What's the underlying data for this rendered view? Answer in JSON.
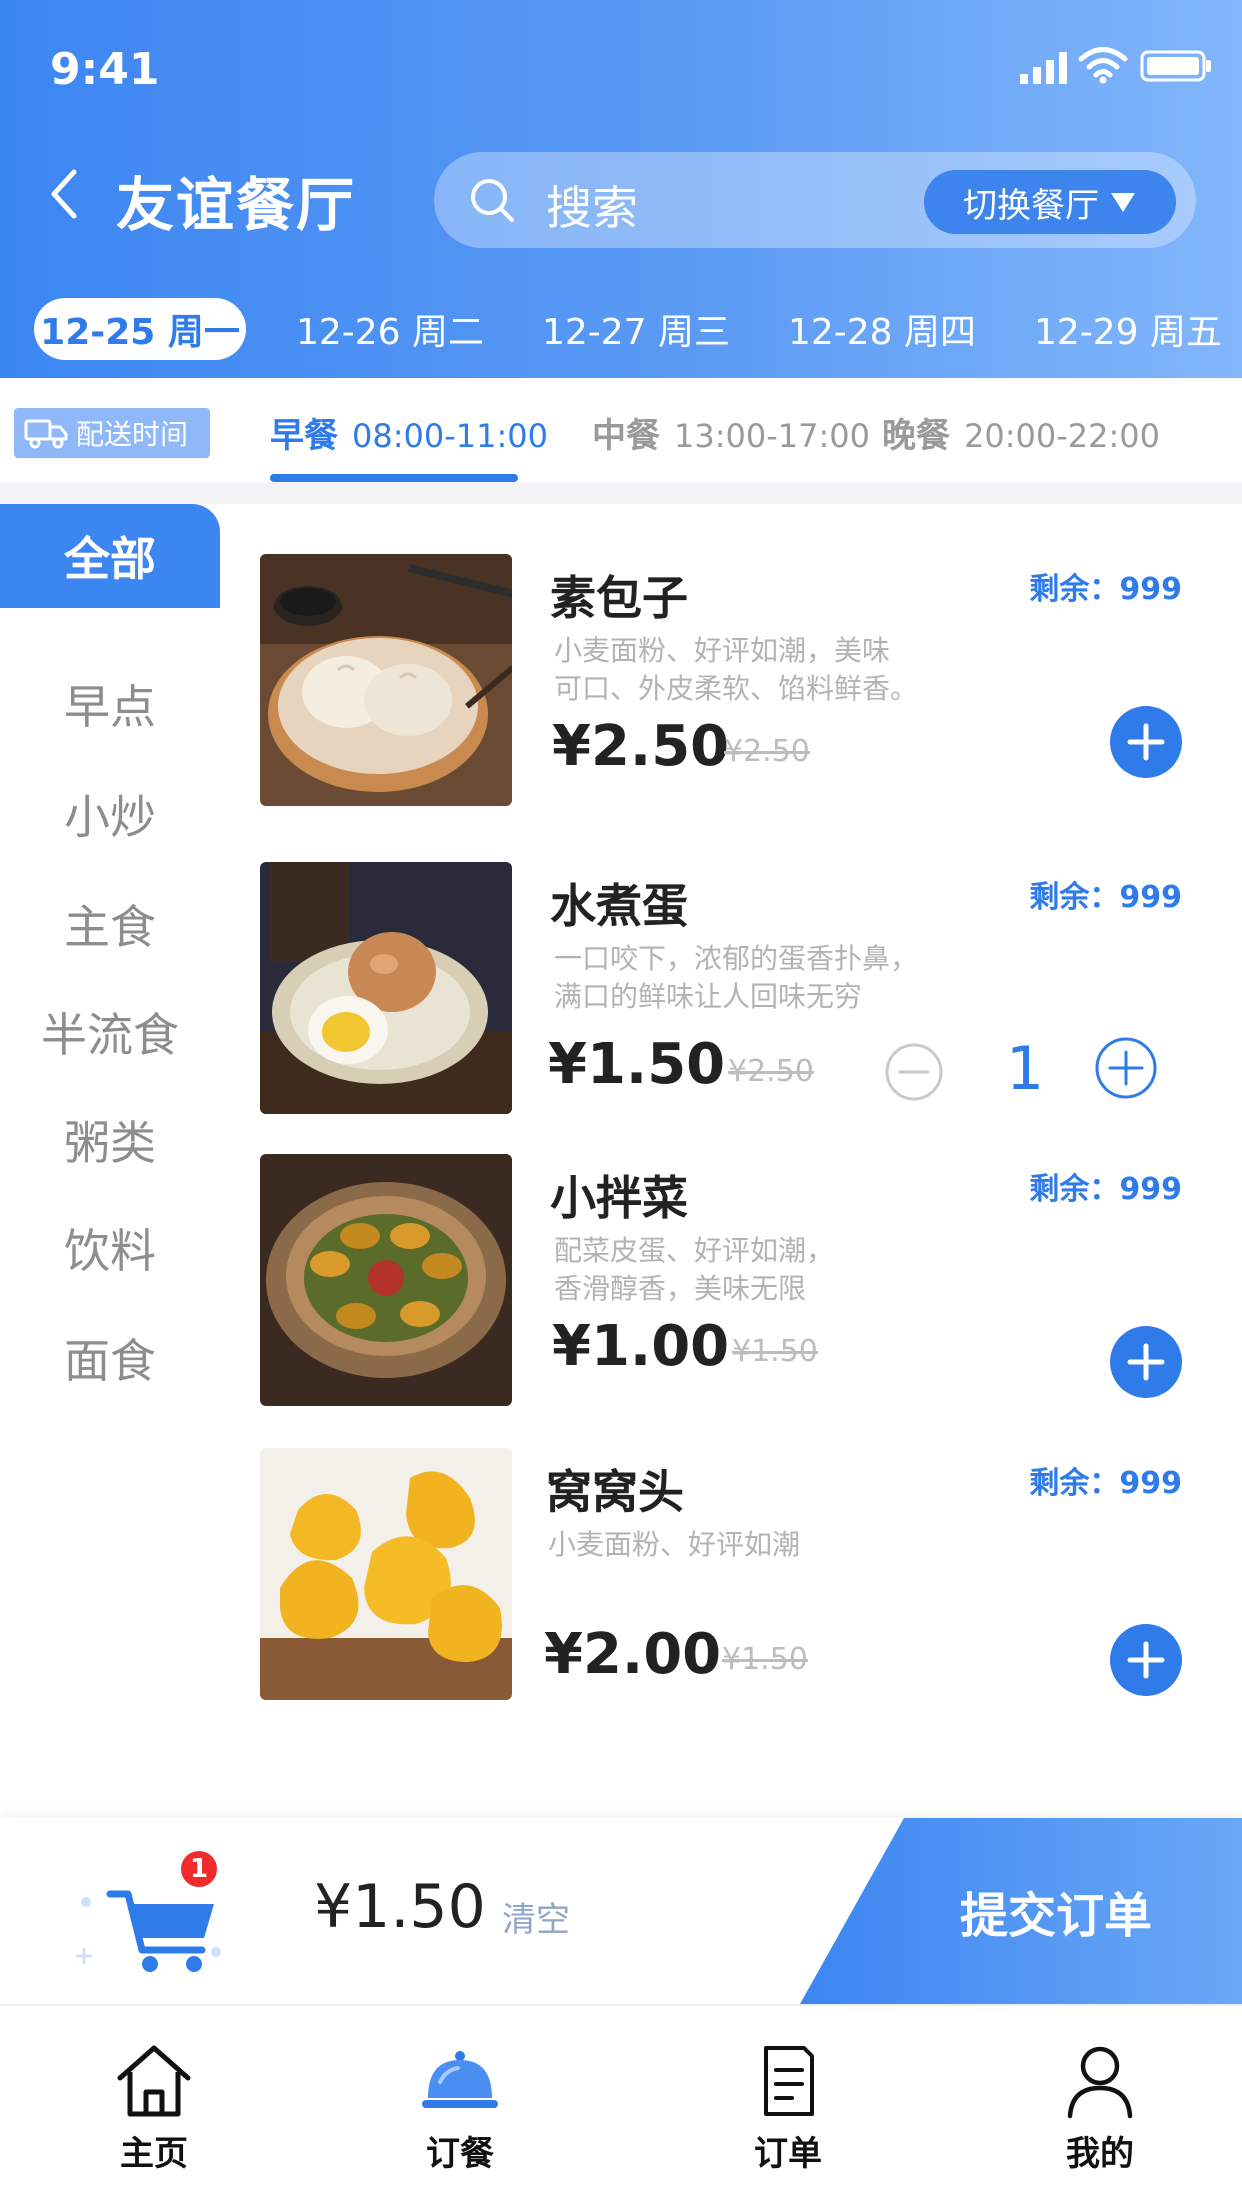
{
  "status_bar": {
    "time": "9:41"
  },
  "header": {
    "title": "友谊餐厅",
    "search_placeholder": "搜索",
    "switch_label": "切换餐厅"
  },
  "date_tabs": [
    {
      "label": "12-25  周一",
      "active": true
    },
    {
      "label": "12-26  周二",
      "active": false
    },
    {
      "label": "12-27  周三",
      "active": false
    },
    {
      "label": "12-28  周四",
      "active": false
    },
    {
      "label": "12-29  周五",
      "active": false
    }
  ],
  "meal_bar": {
    "delivery_label": "配送时间",
    "meals": [
      {
        "name": "早餐",
        "time": "08:00-11:00",
        "active": true
      },
      {
        "name": "中餐",
        "time": "13:00-17:00",
        "active": false
      },
      {
        "name": "晚餐",
        "time": "20:00-22:00",
        "active": false
      }
    ]
  },
  "categories": [
    {
      "label": "全部",
      "active": true
    },
    {
      "label": "早点",
      "active": false
    },
    {
      "label": "小炒",
      "active": false
    },
    {
      "label": "主食",
      "active": false
    },
    {
      "label": "半流食",
      "active": false
    },
    {
      "label": "粥类",
      "active": false
    },
    {
      "label": "饮料",
      "active": false
    },
    {
      "label": "面食",
      "active": false
    }
  ],
  "food_items": [
    {
      "name": "素包子",
      "stock": "剩余：999",
      "desc_line1": "小麦面粉、好评如潮，美味",
      "desc_line2": "可口、外皮柔软、馅料鲜香。",
      "price": "¥2.50",
      "old_price": "¥2.50",
      "photo_icon": "steamed-buns"
    },
    {
      "name": "水煮蛋",
      "stock": "剩余：999",
      "desc_line1": "一口咬下，浓郁的蛋香扑鼻，",
      "desc_line2": "满口的鲜味让人回味无穷",
      "price": "¥1.50",
      "old_price": "¥2.50",
      "quantity": "1",
      "photo_icon": "boiled-eggs"
    },
    {
      "name": "小拌菜",
      "stock": "剩余：999",
      "desc_line1": "配菜皮蛋、好评如潮，",
      "desc_line2": "香滑醇香，美味无限",
      "price": "¥1.00",
      "old_price": "¥1.50",
      "photo_icon": "century-egg-salad"
    },
    {
      "name": "窝窝头",
      "stock": "剩余：999",
      "desc_line1": "小麦面粉、好评如潮",
      "desc_line2": "",
      "price": "¥2.00",
      "old_price": "¥1.50",
      "photo_icon": "cornbread-buns"
    }
  ],
  "cart": {
    "badge_count": "1",
    "total": "¥1.50",
    "clear_label": "清空",
    "submit_label": "提交订单"
  },
  "tab_bar": [
    {
      "label": "主页",
      "icon": "home-icon"
    },
    {
      "label": "订餐",
      "icon": "cloche-icon"
    },
    {
      "label": "订单",
      "icon": "document-icon"
    },
    {
      "label": "我的",
      "icon": "user-icon"
    }
  ],
  "colors": {
    "primary": "#2f7be9",
    "header_start": "#3c86f2",
    "header_end": "#82b6fb",
    "badge_red": "#f02b2b"
  }
}
